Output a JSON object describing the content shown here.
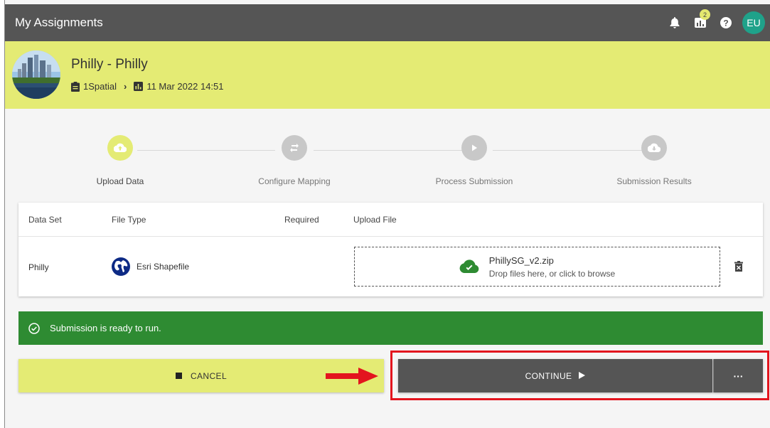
{
  "app": {
    "title": "My Assignments",
    "notification_badge": "2",
    "user_initials": "EU"
  },
  "project": {
    "title": "Philly - Philly",
    "breadcrumb_org": "1Spatial",
    "breadcrumb_date": "11 Mar 2022 14:51"
  },
  "stepper": {
    "steps": [
      {
        "label": "Upload Data",
        "icon": "cloud-upload-icon",
        "state": "active"
      },
      {
        "label": "Configure Mapping",
        "icon": "swap-icon",
        "state": "inactive"
      },
      {
        "label": "Process Submission",
        "icon": "play-icon",
        "state": "inactive"
      },
      {
        "label": "Submission Results",
        "icon": "cloud-download-icon",
        "state": "inactive"
      }
    ]
  },
  "table": {
    "headers": [
      "Data Set",
      "File Type",
      "Required",
      "Upload File"
    ],
    "rows": [
      {
        "data_set": "Philly",
        "file_type": "Esri Shapefile",
        "required": "",
        "file_name": "PhillySG_v2.zip",
        "drop_hint": "Drop files here, or click to browse"
      }
    ]
  },
  "banner": {
    "message": "Submission is ready to run."
  },
  "actions": {
    "cancel_label": "CANCEL",
    "continue_label": "CONTINUE",
    "more_label": "···"
  },
  "colors": {
    "topbar": "#555555",
    "header": "#e4eb74",
    "accent_yellow": "#e4eb74",
    "success": "#2e8b32",
    "avatar": "#1fa28a",
    "highlight": "#e3141e"
  }
}
